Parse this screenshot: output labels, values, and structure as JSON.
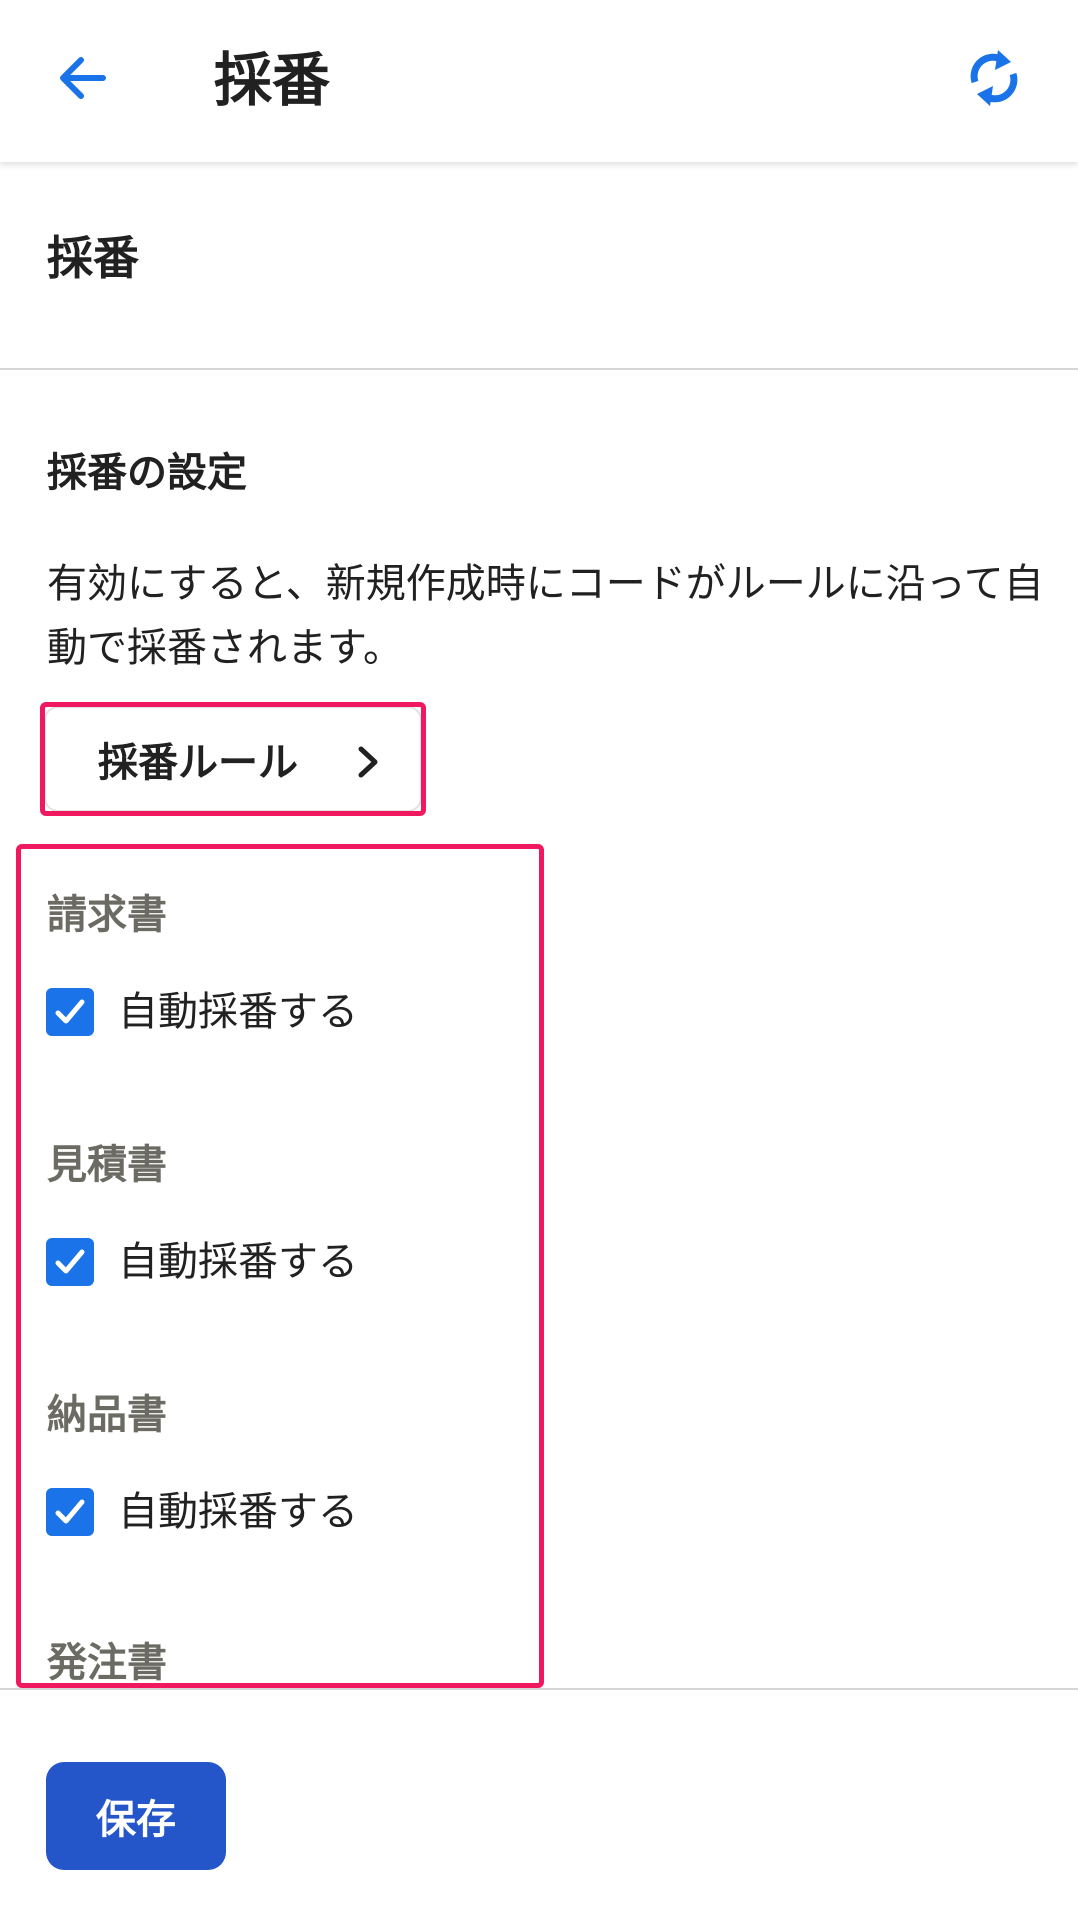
{
  "appbar": {
    "title": "採番",
    "back_icon": "arrow-left-icon",
    "refresh_icon": "refresh-icon"
  },
  "section": {
    "title": "採番"
  },
  "settings": {
    "title": "採番の設定",
    "description": "有効にすると、新規作成時にコードがルールに沿って自動で採番されます。",
    "rule_button_label": "採番ルール"
  },
  "documents": [
    {
      "label": "請求書",
      "checkbox_label": "自動採番する",
      "checked": true
    },
    {
      "label": "見積書",
      "checkbox_label": "自動採番する",
      "checked": true
    },
    {
      "label": "納品書",
      "checkbox_label": "自動採番する",
      "checked": true
    },
    {
      "label": "発注書"
    }
  ],
  "footer": {
    "save_label": "保存"
  },
  "colors": {
    "accent_blue": "#1a73e8",
    "save_button": "#2456c9",
    "highlight": "#f0195f",
    "doc_label_gray": "#6b6b63"
  }
}
